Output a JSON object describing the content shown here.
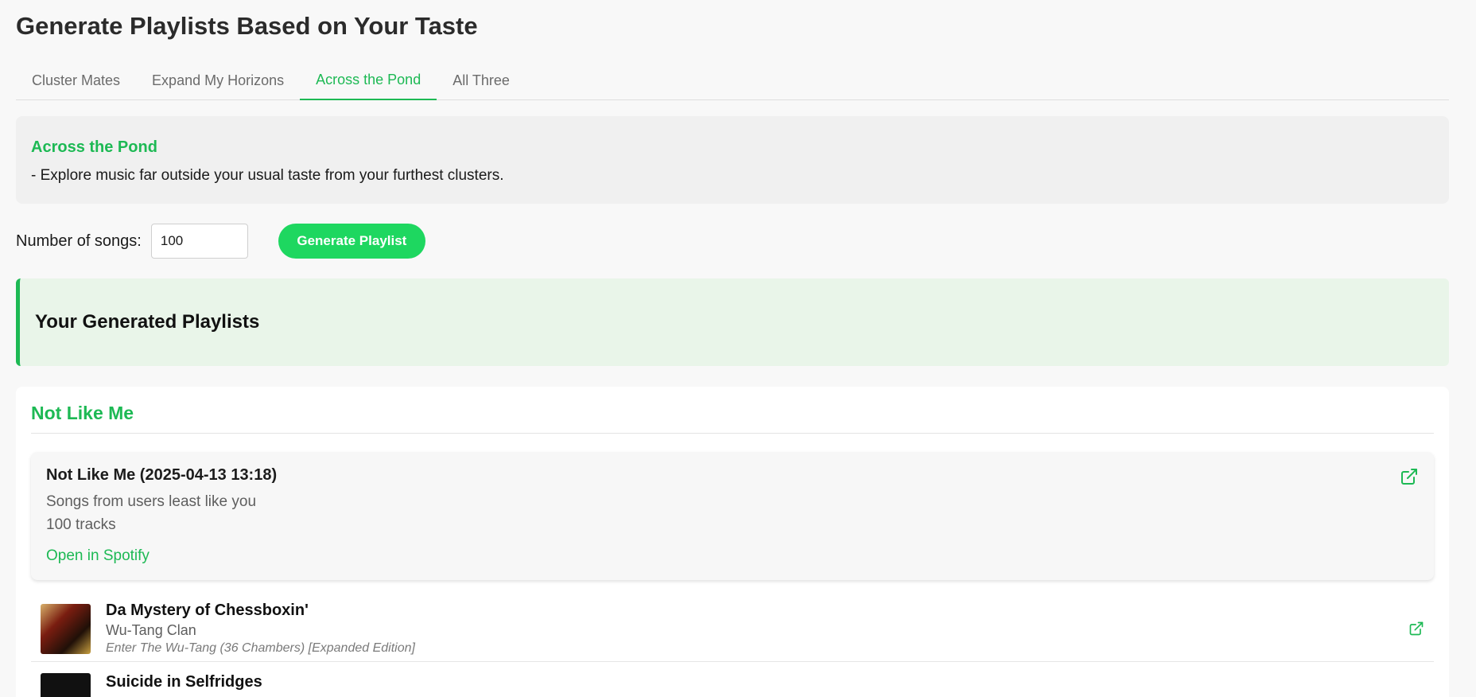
{
  "page_title": "Generate Playlists Based on Your Taste",
  "tabs": [
    {
      "label": "Cluster Mates",
      "active": false
    },
    {
      "label": "Expand My Horizons",
      "active": false
    },
    {
      "label": "Across the Pond",
      "active": true
    },
    {
      "label": "All Three",
      "active": false
    }
  ],
  "info": {
    "title": "Across the Pond",
    "description": "- Explore music far outside your usual taste from your furthest clusters."
  },
  "controls": {
    "count_label": "Number of songs:",
    "count_value": "100",
    "generate_label": "Generate Playlist"
  },
  "generated": {
    "heading": "Your Generated Playlists"
  },
  "playlist": {
    "name": "Not Like Me",
    "info_title": "Not Like Me (2025-04-13 13:18)",
    "info_description": "Songs from users least like you",
    "info_count": "100 tracks",
    "open_link": "Open in Spotify",
    "tracks": [
      {
        "name": "Da Mystery of Chessboxin'",
        "artist": "Wu-Tang Clan",
        "album": "Enter The Wu-Tang (36 Chambers) [Expanded Edition]"
      },
      {
        "name": "Suicide in Selfridges",
        "artist": "",
        "album": ""
      }
    ]
  },
  "colors": {
    "accent": "#1db954",
    "button": "#1ed760",
    "generated_bg": "#e9f5e9"
  },
  "icons": {
    "external_link": "external-link-icon"
  }
}
